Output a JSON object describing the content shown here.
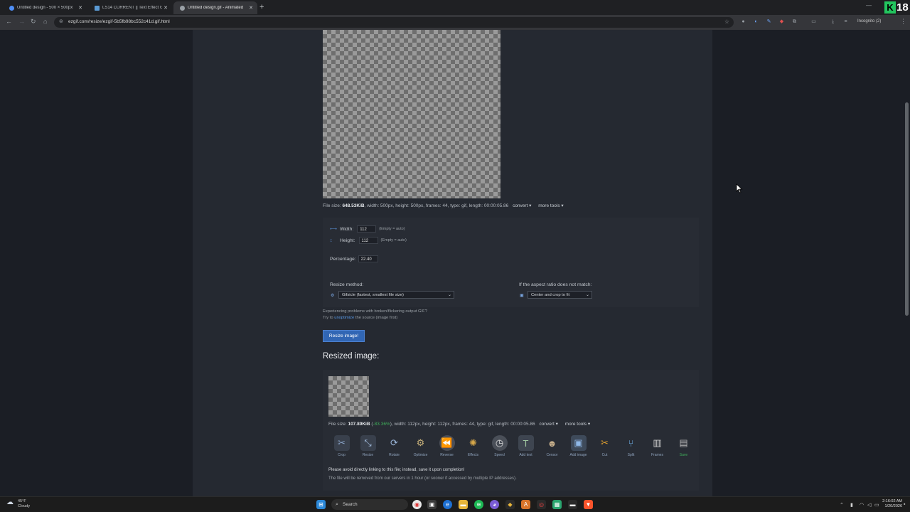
{
  "browser": {
    "tabs": [
      {
        "label": "Untitled design - 500 × 500px",
        "favicon_color": "#4f8ff7"
      },
      {
        "label": "LS14 CURRENT || Text Effect Gen",
        "favicon_color": "#5b9bd5"
      },
      {
        "label": "Untitled design.gif - Animated",
        "favicon_color": "#9aa0a6"
      }
    ],
    "url": "ezgif.com/resize/ezgif-5b5fb98bc552c41d.gif.html",
    "profile_label": "Incognito (2)",
    "k_badge": "K",
    "k_number": "18"
  },
  "source": {
    "info_prefix": "File size: ",
    "size": "648.53KiB",
    "info_rest": ", width: 500px, height: 500px, frames: 44, type: gif, length: 00:00:05.86",
    "convert_label": "convert ▾",
    "more_tools_label": "more tools ▾"
  },
  "form": {
    "width_label": "Width:",
    "width_value": "112",
    "width_hint": "(Empty = auto)",
    "height_label": "Height:",
    "height_value": "112",
    "height_hint": "(Empty = auto)",
    "percentage_label": "Percentage:",
    "percentage_value": "22.40",
    "method_label": "Resize method:",
    "method_value": "Gifsicle (fastest, smallest file size)",
    "aspect_label": "If the aspect ratio does not match:",
    "aspect_value": "Center and crop to fit",
    "warn_line1": "Experiencing problems with broken/flickering output GIF?",
    "warn_prefix": "Try to ",
    "warn_link": "unoptimize",
    "warn_suffix": " the source (image first)",
    "resize_button": "Resize image!"
  },
  "result": {
    "title": "Resized image:",
    "info_prefix": "File size: ",
    "size": "107.89KiB",
    "info_open": " (",
    "savings": "-83.36%",
    "info_rest": "), width: 112px, height: 112px, frames: 44, type: gif, length: 00:00:05.86",
    "convert_label": "convert ▾",
    "more_tools_label": "more tools ▾",
    "tools": [
      {
        "name": "Crop",
        "icon": "crop-icon",
        "glyph": "✂",
        "color": "#8aa4c8",
        "green": false
      },
      {
        "name": "Resize",
        "icon": "resize-icon",
        "glyph": "⤡",
        "color": "#a9c4e6",
        "green": false
      },
      {
        "name": "Rotate",
        "icon": "rotate-icon",
        "glyph": "⟳",
        "color": "#9ab6da",
        "green": false
      },
      {
        "name": "Optimize",
        "icon": "optimize-icon",
        "glyph": "⚙",
        "color": "#c9b27a",
        "green": false
      },
      {
        "name": "Reverse",
        "icon": "reverse-icon",
        "glyph": "⏪",
        "color": "#d0d0d0",
        "green": false
      },
      {
        "name": "Effects",
        "icon": "effects-icon",
        "glyph": "✺",
        "color": "#d7a84a",
        "green": false
      },
      {
        "name": "Speed",
        "icon": "speed-icon",
        "glyph": "◷",
        "color": "#dcdcdc",
        "green": false
      },
      {
        "name": "Add text",
        "icon": "add-text-icon",
        "glyph": "T",
        "color": "#9fc6a0",
        "green": false
      },
      {
        "name": "Censor",
        "icon": "censor-icon",
        "glyph": "☻",
        "color": "#c8b08c",
        "green": false
      },
      {
        "name": "Add image",
        "icon": "add-image-icon",
        "glyph": "▣",
        "color": "#8fb8e8",
        "green": false
      },
      {
        "name": "Cut",
        "icon": "cut-icon",
        "glyph": "✂",
        "color": "#e0a030",
        "green": false
      },
      {
        "name": "Split",
        "icon": "split-icon",
        "glyph": "⑂",
        "color": "#6fb0e8",
        "green": false
      },
      {
        "name": "Frames",
        "icon": "frames-icon",
        "glyph": "▥",
        "color": "#d0d0d0",
        "green": false
      },
      {
        "name": "Save",
        "icon": "save-icon",
        "glyph": "▤",
        "color": "#b8b8b8",
        "green": true
      }
    ],
    "note1": "Please avoid directly linking to this file; instead, save it upon completion!",
    "note2": "The file will be removed from our servers in 1 hour (or sooner if accessed by multiple IP addresses)."
  },
  "taskbar": {
    "temp": "45°F",
    "condition": "Cloudy",
    "search_label": "Search",
    "time": "2:16:02 AM",
    "date": "1/20/2026"
  },
  "colors": {
    "accent_blue": "#3166b4",
    "savings_green": "#3fae5a",
    "link_blue": "#5a9ae6"
  }
}
